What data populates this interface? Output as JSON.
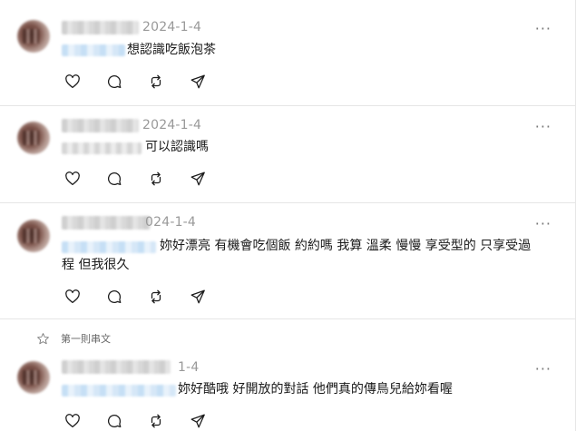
{
  "posts": [
    {
      "date": "2024-1-4",
      "text": "想認識吃飯泡茶",
      "more": "···"
    },
    {
      "date": "2024-1-4",
      "text": "可以認識嗎",
      "more": "···"
    },
    {
      "date": "024-1-4",
      "text": "妳好漂亮 有機會吃個飯 約約嗎 我算 溫柔 慢慢 享受型的 只享受過",
      "text2": "程 但我很久",
      "more": "···"
    },
    {
      "date": "1-4",
      "text": "妳好酷哦 好開放的對話 他們真的傳鳥兒給妳看喔",
      "more": "···"
    }
  ],
  "thread_label": "第一則串文",
  "icons": {
    "like": "heart-icon",
    "reply": "comment-icon",
    "repost": "repost-icon",
    "share": "send-icon",
    "thread": "star-icon",
    "more": "more-icon"
  }
}
